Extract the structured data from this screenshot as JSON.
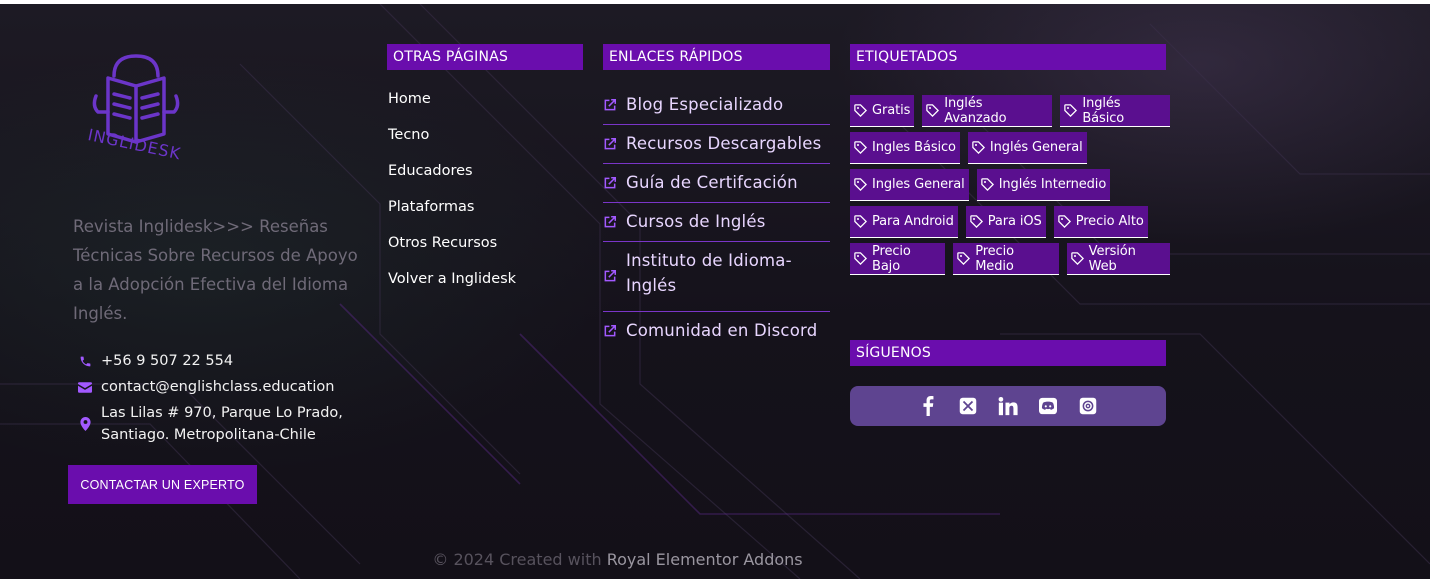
{
  "brand": {
    "logo_text": "INGLIDESK"
  },
  "tagline": "Revista Inglidesk>>> Reseñas Técnicas Sobre Recursos de Apoyo a la Adopción Efectiva del Idioma Inglés.",
  "contact": {
    "phone": "+56 9 507 22 554",
    "email": "contact@englishclass.education",
    "address_line1": "Las Lilas # 970, Parque Lo Prado,",
    "address_line2": "Santiago. Metropolitana-Chile",
    "cta_label": "CONTACTAR UN EXPERTO"
  },
  "other_pages": {
    "heading": "OTRAS PÁGINAS",
    "items": [
      "Home",
      "Tecno",
      "Educadores",
      "Plataformas",
      "Otros Recursos",
      "Volver a Inglidesk"
    ]
  },
  "quick_links": {
    "heading": "ENLACES RÁPIDOS",
    "items": [
      "Blog Especializado",
      "Recursos Descargables",
      "Guía de Certifcación",
      "Cursos de Inglés",
      "Instituto de Idioma-Inglés",
      "Comunidad en Discord"
    ]
  },
  "tags": {
    "heading": "ETIQUETADOS",
    "rows": [
      [
        "Gratis",
        "Inglés Avanzado",
        "Inglés Básico"
      ],
      [
        "Ingles Básico",
        "Inglés General"
      ],
      [
        "Ingles General",
        "Inglés Internedio"
      ],
      [
        "Para Android",
        "Para iOS",
        "Precio Alto"
      ],
      [
        "Precio Bajo",
        "Precio Medio",
        "Versión Web"
      ]
    ]
  },
  "follow": {
    "heading": "SÍGUENOS",
    "icons": [
      "facebook-icon",
      "x-twitter-icon",
      "linkedin-icon",
      "discord-icon",
      "threads-icon"
    ]
  },
  "footer": {
    "copyright_prefix": "© 2024 Created with ",
    "copyright_link": "Royal Elementor Addons"
  },
  "colors": {
    "accent": "#6a0dad",
    "tag_bg": "#5a0f8f",
    "social_bg": "#5e4490",
    "link_text": "#e8d6ff",
    "icon_purple": "#a259ff"
  }
}
